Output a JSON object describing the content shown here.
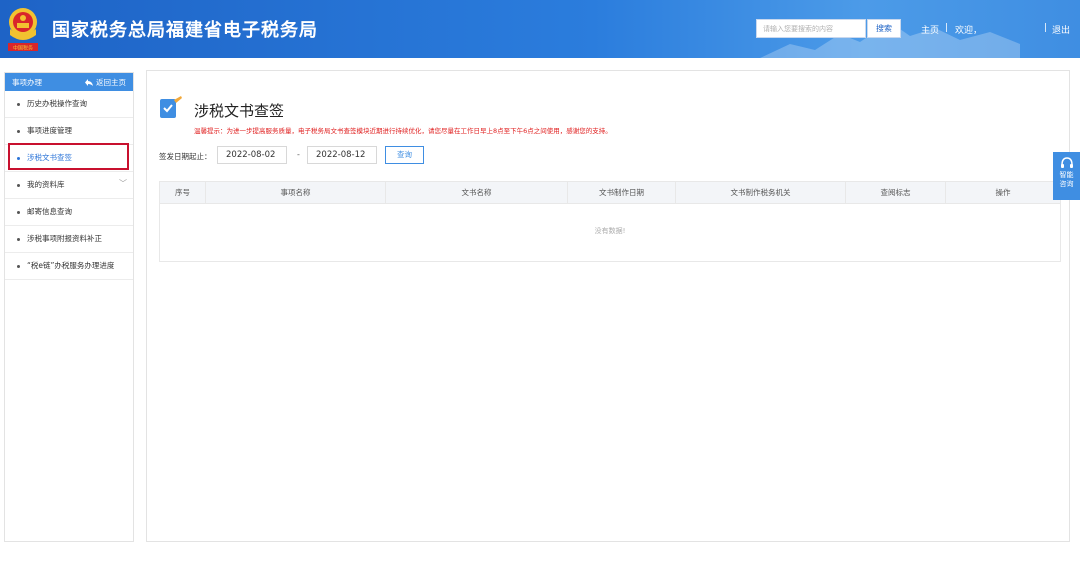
{
  "header": {
    "site_title": "国家税务总局福建省电子税务局",
    "search_placeholder": "请输入您要搜索的内容",
    "search_button": "搜索",
    "home_link": "主页",
    "welcome_text": "欢迎",
    "logout_link": "退出",
    "emblem_caption": "中国税务"
  },
  "sidebar": {
    "title": "事项办理",
    "back_label": "返回主页",
    "items": [
      {
        "label": "历史办税操作查询"
      },
      {
        "label": "事项进度管理"
      },
      {
        "label": "涉税文书查签"
      },
      {
        "label": "我的资料库"
      },
      {
        "label": "邮寄信息查询"
      },
      {
        "label": "涉税事项附报资料补正"
      },
      {
        "label": "“税e链”办税服务办理进度"
      }
    ]
  },
  "main": {
    "page_title": "涉税文书查签",
    "notice": "温馨提示：为进一步提高服务质量，电子税务局文书查签模块近期进行持续优化，请您尽量在工作日早上8点至下午6点之间使用，感谢您的支持。",
    "filter_label": "签发日期起止：",
    "date_start": "2022-08-02",
    "date_separator": "-",
    "date_end": "2022-08-12",
    "query_button": "查询",
    "table": {
      "columns": [
        "序号",
        "事项名称",
        "文书名称",
        "文书制作日期",
        "文书制作税务机关",
        "查阅标志",
        "操作"
      ],
      "empty_text": "没有数据!"
    }
  },
  "float_help": {
    "label_line1": "智能",
    "label_line2": "咨询"
  },
  "colors": {
    "header_blue": "#2b7ddd",
    "accent_blue": "#3f8ee2",
    "notice_red": "#e02020",
    "highlight_red": "#c8102e"
  }
}
